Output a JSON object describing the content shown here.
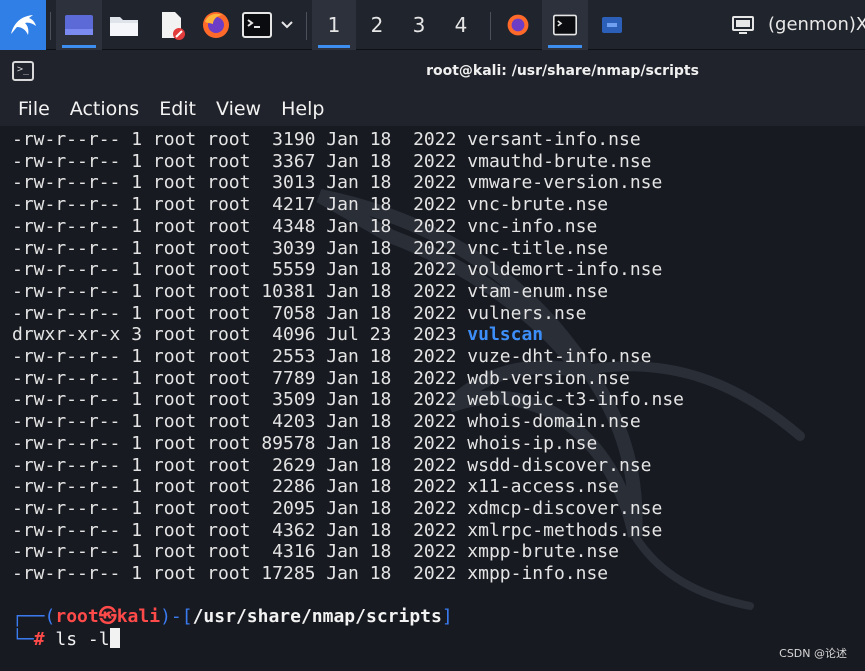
{
  "taskbar": {
    "workspaces": [
      "1",
      "2",
      "3",
      "4"
    ],
    "active_workspace": "1",
    "genmon_label": "(genmon)X",
    "colors": {
      "panel": "#20242c",
      "accent": "#3e8ef0"
    }
  },
  "window": {
    "title": "root@kali: /usr/share/nmap/scripts",
    "menu": [
      "File",
      "Actions",
      "Edit",
      "View",
      "Help"
    ]
  },
  "listing": [
    {
      "perm": "-rw-r--r--",
      "links": "1",
      "owner": "root",
      "group": "root",
      "size": "3190",
      "month": "Jan",
      "day": "18",
      "year": "2022",
      "name": "versant-info.nse",
      "is_dir": false
    },
    {
      "perm": "-rw-r--r--",
      "links": "1",
      "owner": "root",
      "group": "root",
      "size": "3367",
      "month": "Jan",
      "day": "18",
      "year": "2022",
      "name": "vmauthd-brute.nse",
      "is_dir": false
    },
    {
      "perm": "-rw-r--r--",
      "links": "1",
      "owner": "root",
      "group": "root",
      "size": "3013",
      "month": "Jan",
      "day": "18",
      "year": "2022",
      "name": "vmware-version.nse",
      "is_dir": false
    },
    {
      "perm": "-rw-r--r--",
      "links": "1",
      "owner": "root",
      "group": "root",
      "size": "4217",
      "month": "Jan",
      "day": "18",
      "year": "2022",
      "name": "vnc-brute.nse",
      "is_dir": false
    },
    {
      "perm": "-rw-r--r--",
      "links": "1",
      "owner": "root",
      "group": "root",
      "size": "4348",
      "month": "Jan",
      "day": "18",
      "year": "2022",
      "name": "vnc-info.nse",
      "is_dir": false
    },
    {
      "perm": "-rw-r--r--",
      "links": "1",
      "owner": "root",
      "group": "root",
      "size": "3039",
      "month": "Jan",
      "day": "18",
      "year": "2022",
      "name": "vnc-title.nse",
      "is_dir": false
    },
    {
      "perm": "-rw-r--r--",
      "links": "1",
      "owner": "root",
      "group": "root",
      "size": "5559",
      "month": "Jan",
      "day": "18",
      "year": "2022",
      "name": "voldemort-info.nse",
      "is_dir": false
    },
    {
      "perm": "-rw-r--r--",
      "links": "1",
      "owner": "root",
      "group": "root",
      "size": "10381",
      "month": "Jan",
      "day": "18",
      "year": "2022",
      "name": "vtam-enum.nse",
      "is_dir": false
    },
    {
      "perm": "-rw-r--r--",
      "links": "1",
      "owner": "root",
      "group": "root",
      "size": "7058",
      "month": "Jan",
      "day": "18",
      "year": "2022",
      "name": "vulners.nse",
      "is_dir": false
    },
    {
      "perm": "drwxr-xr-x",
      "links": "3",
      "owner": "root",
      "group": "root",
      "size": "4096",
      "month": "Jul",
      "day": "23",
      "year": "2023",
      "name": "vulscan",
      "is_dir": true
    },
    {
      "perm": "-rw-r--r--",
      "links": "1",
      "owner": "root",
      "group": "root",
      "size": "2553",
      "month": "Jan",
      "day": "18",
      "year": "2022",
      "name": "vuze-dht-info.nse",
      "is_dir": false
    },
    {
      "perm": "-rw-r--r--",
      "links": "1",
      "owner": "root",
      "group": "root",
      "size": "7789",
      "month": "Jan",
      "day": "18",
      "year": "2022",
      "name": "wdb-version.nse",
      "is_dir": false
    },
    {
      "perm": "-rw-r--r--",
      "links": "1",
      "owner": "root",
      "group": "root",
      "size": "3509",
      "month": "Jan",
      "day": "18",
      "year": "2022",
      "name": "weblogic-t3-info.nse",
      "is_dir": false
    },
    {
      "perm": "-rw-r--r--",
      "links": "1",
      "owner": "root",
      "group": "root",
      "size": "4203",
      "month": "Jan",
      "day": "18",
      "year": "2022",
      "name": "whois-domain.nse",
      "is_dir": false
    },
    {
      "perm": "-rw-r--r--",
      "links": "1",
      "owner": "root",
      "group": "root",
      "size": "89578",
      "month": "Jan",
      "day": "18",
      "year": "2022",
      "name": "whois-ip.nse",
      "is_dir": false
    },
    {
      "perm": "-rw-r--r--",
      "links": "1",
      "owner": "root",
      "group": "root",
      "size": "2629",
      "month": "Jan",
      "day": "18",
      "year": "2022",
      "name": "wsdd-discover.nse",
      "is_dir": false
    },
    {
      "perm": "-rw-r--r--",
      "links": "1",
      "owner": "root",
      "group": "root",
      "size": "2286",
      "month": "Jan",
      "day": "18",
      "year": "2022",
      "name": "x11-access.nse",
      "is_dir": false
    },
    {
      "perm": "-rw-r--r--",
      "links": "1",
      "owner": "root",
      "group": "root",
      "size": "2095",
      "month": "Jan",
      "day": "18",
      "year": "2022",
      "name": "xdmcp-discover.nse",
      "is_dir": false
    },
    {
      "perm": "-rw-r--r--",
      "links": "1",
      "owner": "root",
      "group": "root",
      "size": "4362",
      "month": "Jan",
      "day": "18",
      "year": "2022",
      "name": "xmlrpc-methods.nse",
      "is_dir": false
    },
    {
      "perm": "-rw-r--r--",
      "links": "1",
      "owner": "root",
      "group": "root",
      "size": "4316",
      "month": "Jan",
      "day": "18",
      "year": "2022",
      "name": "xmpp-brute.nse",
      "is_dir": false
    },
    {
      "perm": "-rw-r--r--",
      "links": "1",
      "owner": "root",
      "group": "root",
      "size": "17285",
      "month": "Jan",
      "day": "18",
      "year": "2022",
      "name": "xmpp-info.nse",
      "is_dir": false
    }
  ],
  "prompt": {
    "user": "root",
    "at_symbol": "㉿",
    "host": "kali",
    "cwd": "/usr/share/nmap/scripts",
    "symbol": "#",
    "command": "ls -l"
  },
  "watermark": "CSDN @论述",
  "colors": {
    "terminal_bg": "#171a21",
    "text": "#e4e4e4",
    "directory": "#3d8ef8",
    "prompt_frame": "#3b7bf0",
    "prompt_user": "#ff4a4a"
  }
}
